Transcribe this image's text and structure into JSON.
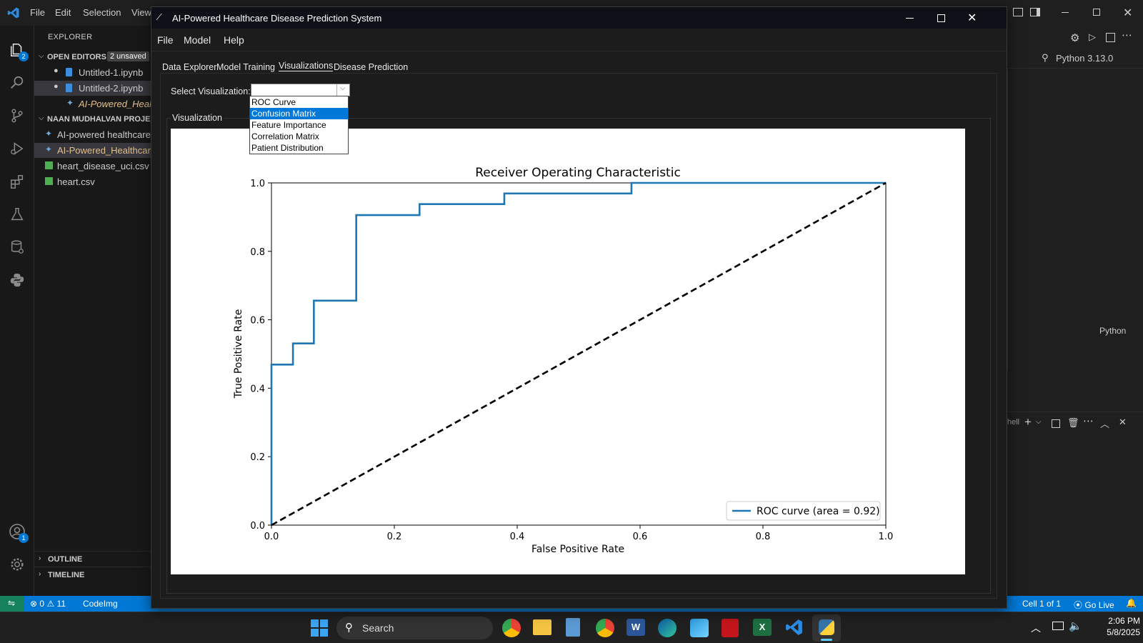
{
  "vscode": {
    "menu": [
      "File",
      "Edit",
      "Selection",
      "View"
    ],
    "explorer_title": "EXPLORER",
    "open_editors": {
      "label": "OPEN EDITORS",
      "badge": "2 unsaved",
      "files": [
        "Untitled-1.ipynb",
        "Untitled-2.ipynb",
        "AI-Powered_Heal"
      ]
    },
    "project": {
      "label": "NAAN MUDHALVAN PROJE",
      "files": [
        "AI-powered healthcare",
        "AI-Powered_Healthcare",
        "heart_disease_uci.csv",
        "heart.csv"
      ]
    },
    "outline": "OUTLINE",
    "timeline": "TIMELINE",
    "kernel": "Python 3.13.0",
    "lang": "Python",
    "panel_label": "hell",
    "badges": {
      "explorer": "2",
      "accounts": "1"
    },
    "status": {
      "errors": "0",
      "warnings": "11",
      "project": "CodeImg",
      "cell": "Cell 1 of 1",
      "golive": "Go Live"
    }
  },
  "app": {
    "title": "AI-Powered Healthcare Disease Prediction System",
    "menu": [
      "File",
      "Model",
      "Help"
    ],
    "tabs": [
      "Data Explorer",
      "Model Training",
      "Visualizations",
      "Disease Prediction"
    ],
    "select_label": "Select Visualization:",
    "select_value": "",
    "options": [
      "ROC Curve",
      "Confusion Matrix",
      "Feature Importance",
      "Correlation Matrix",
      "Patient Distribution"
    ],
    "highlighted_option": "Confusion Matrix",
    "frame_label": "Visualization"
  },
  "chart_data": {
    "type": "line",
    "title": "Receiver Operating Characteristic",
    "xlabel": "False Positive Rate",
    "ylabel": "True Positive Rate",
    "xlim": [
      0.0,
      1.0
    ],
    "ylim": [
      0.0,
      1.0
    ],
    "xticks": [
      "0.0",
      "0.2",
      "0.4",
      "0.6",
      "0.8",
      "1.0"
    ],
    "yticks": [
      "0.0",
      "0.2",
      "0.4",
      "0.6",
      "0.8",
      "1.0"
    ],
    "grid": false,
    "legend_position": "lower right",
    "series": [
      {
        "name": "ROC curve (area = 0.92)",
        "color": "#1f77b4",
        "style": "step",
        "x": [
          0.0,
          0.0,
          0.035,
          0.035,
          0.069,
          0.069,
          0.138,
          0.138,
          0.241,
          0.241,
          0.379,
          0.379,
          0.586,
          0.586,
          1.0
        ],
        "y": [
          0.0,
          0.469,
          0.469,
          0.531,
          0.531,
          0.656,
          0.656,
          0.906,
          0.906,
          0.938,
          0.938,
          0.969,
          0.969,
          1.0,
          1.0
        ]
      },
      {
        "color": "#000000",
        "style": "dashed",
        "x": [
          0.0,
          1.0
        ],
        "y": [
          0.0,
          1.0
        ]
      }
    ]
  },
  "taskbar": {
    "search": "Search",
    "time": "2:06 PM",
    "date": "5/8/2025"
  }
}
